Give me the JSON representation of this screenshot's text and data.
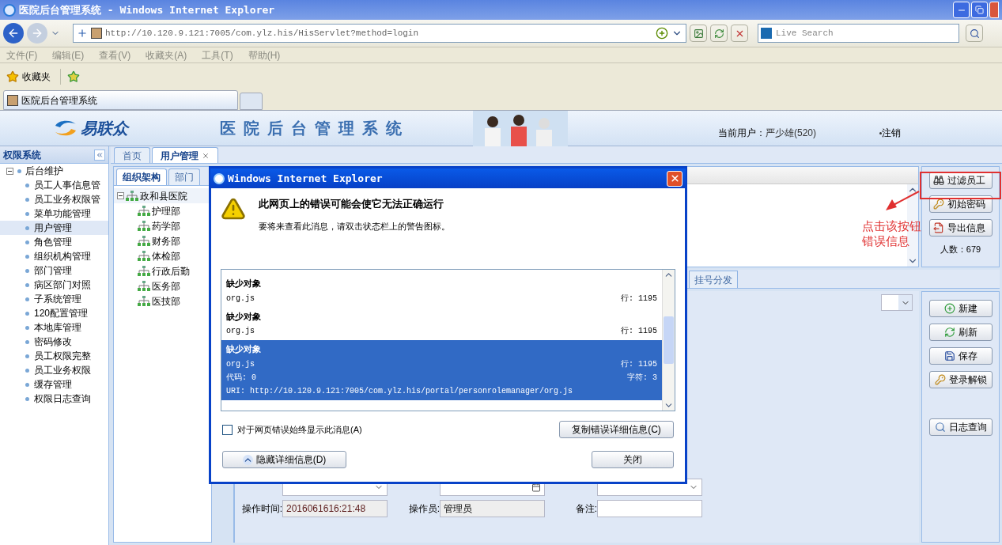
{
  "window": {
    "title": "医院后台管理系统 - Windows Internet Explorer"
  },
  "address_bar": {
    "url": "http://10.120.9.121:7005/com.ylz.his/HisServlet?method=login"
  },
  "search": {
    "placeholder": "Live Search"
  },
  "menu": [
    "文件(F)",
    "编辑(E)",
    "查看(V)",
    "收藏夹(A)",
    "工具(T)",
    "帮助(H)"
  ],
  "favorites": {
    "label": "收藏夹"
  },
  "browser_tab": {
    "label": "医院后台管理系统"
  },
  "app_header": {
    "logo": "易联众",
    "title": "医院后台管理系统",
    "user_label": "当前用户：",
    "user_name": "严少雄(520)",
    "logout": "注销"
  },
  "sidebar": {
    "title": "权限系统",
    "tree": [
      {
        "label": "后台维护",
        "expanded": true,
        "children": [
          {
            "label": "员工人事信息管",
            "selected": false
          },
          {
            "label": "员工业务权限管",
            "selected": false
          },
          {
            "label": "菜单功能管理",
            "selected": false
          },
          {
            "label": "用户管理",
            "selected": true
          },
          {
            "label": "角色管理",
            "selected": false
          },
          {
            "label": "组织机构管理",
            "selected": false
          },
          {
            "label": "部门管理",
            "selected": false
          },
          {
            "label": "病区部门对照",
            "selected": false
          },
          {
            "label": "子系统管理",
            "selected": false
          },
          {
            "label": "120配置管理",
            "selected": false
          },
          {
            "label": "本地库管理",
            "selected": false
          },
          {
            "label": "密码修改",
            "selected": false
          },
          {
            "label": "员工权限完整",
            "selected": false
          },
          {
            "label": "员工业务权限",
            "selected": false
          },
          {
            "label": "缓存管理",
            "selected": false
          },
          {
            "label": "权限日志查询",
            "selected": false
          }
        ]
      }
    ]
  },
  "main_tabs": [
    {
      "label": "首页",
      "selected": false
    },
    {
      "label": "用户管理",
      "selected": true
    }
  ],
  "org_panel": {
    "tabs": [
      {
        "label": "组织架构",
        "selected": true
      },
      {
        "label": "部门",
        "selected": false
      }
    ],
    "tree": [
      {
        "label": "政和县医院",
        "expanded": true,
        "children": [
          {
            "label": "护理部"
          },
          {
            "label": "药学部"
          },
          {
            "label": "财务部"
          },
          {
            "label": "体检部"
          },
          {
            "label": "行政后勤"
          },
          {
            "label": "医务部"
          },
          {
            "label": "医技部"
          }
        ]
      }
    ]
  },
  "list_actions": [
    {
      "label": "过滤员工",
      "kind": "filter"
    },
    {
      "label": "初始密码",
      "kind": "key"
    },
    {
      "label": "导出信息",
      "kind": "export"
    }
  ],
  "count": "人数：679",
  "lower_tabs": [
    {
      "label": "挂号分发",
      "selected": false
    }
  ],
  "form_actions": [
    {
      "label": "新建",
      "kind": "new"
    },
    {
      "label": "刷新",
      "kind": "refresh"
    },
    {
      "label": "保存",
      "kind": "save"
    },
    {
      "label": "登录解锁",
      "kind": "key"
    },
    {
      "label": "日志查询",
      "kind": "search"
    }
  ],
  "form_rows": [
    [
      {
        "kind": "select"
      },
      {
        "kind": "date"
      },
      {
        "kind": "select"
      }
    ],
    [
      {
        "kind": "text",
        "label": "操作时间:",
        "value": "2016061616:21:48"
      },
      {
        "kind": "text",
        "label": "操作员:",
        "value": "管理员"
      },
      {
        "kind": "text",
        "label": "备注:"
      }
    ]
  ],
  "annotation": {
    "lines": [
      "点击该按钮",
      "错误信息"
    ]
  },
  "dialog": {
    "title": "Windows Internet Explorer",
    "heading": "此网页上的错误可能会使它无法正确运行",
    "message": "要将来查看此消息，请双击状态栏上的警告图标。",
    "errors": [
      {
        "title": "缺少对象",
        "file": "org.js",
        "line": "行: 1195",
        "selected": false
      },
      {
        "title": "缺少对象",
        "file": "org.js",
        "line": "行: 1195",
        "selected": false
      },
      {
        "title": "缺少对象",
        "file": "org.js",
        "line": "行: 1195",
        "code": "代码: 0",
        "char": "字符: 3",
        "uri": "URI: http://10.120.9.121:7005/com.ylz.his/portal/personrolemanager/org.js",
        "selected": true
      }
    ],
    "checkbox": {
      "label": "对于网页错误始终显示此消息(A)",
      "checked": false
    },
    "copy_button": "复制错误详细信息(C)",
    "details_button": "隐藏详细信息(D)",
    "close_button": "关闭"
  }
}
